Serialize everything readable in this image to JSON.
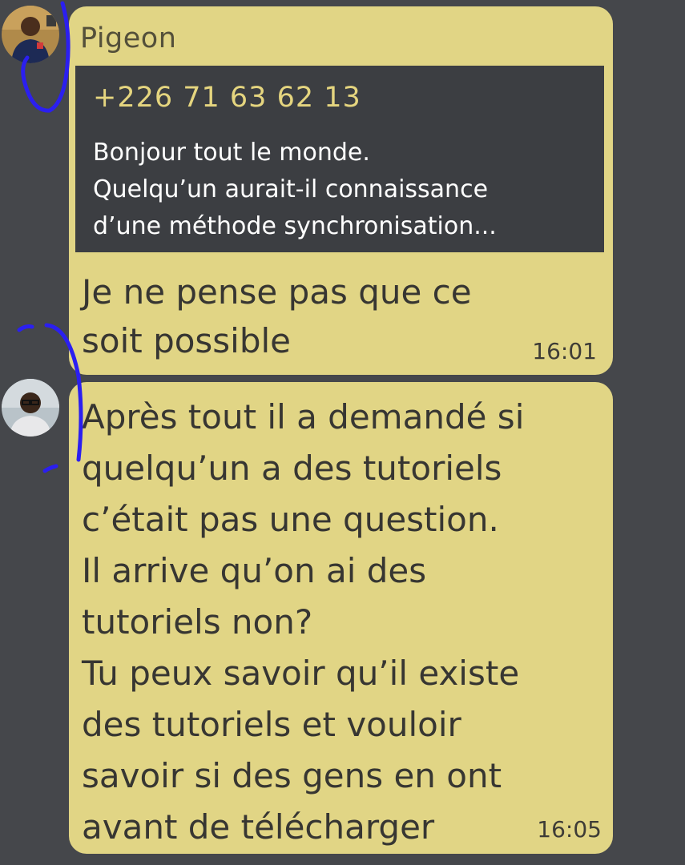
{
  "messages": [
    {
      "sender": "Pigeon",
      "quote": {
        "sender": "+226 71 63 62 13",
        "text": "Bonjour tout le monde.\nQuelqu’un aurait-il connaissance\nd’une méthode synchronisation..."
      },
      "text": "Je ne pense pas que ce\nsoit possible",
      "time": "16:01"
    },
    {
      "text": "Après tout il a demandé si\nquelqu’un a des tutoriels\nc’était pas une question.\nIl arrive qu’on ai des\ntutoriels non?\nTu peux savoir qu’il existe\ndes tutoriels et vouloir\nsavoir si des gens en ont\navant de télécharger",
      "time": "16:05"
    }
  ],
  "colors": {
    "background": "#45474b",
    "bubble": "#e1d585",
    "quote_background": "#3c3e42",
    "quote_sender": "#e5d57f",
    "annotation_ink": "#2b1ff0"
  }
}
